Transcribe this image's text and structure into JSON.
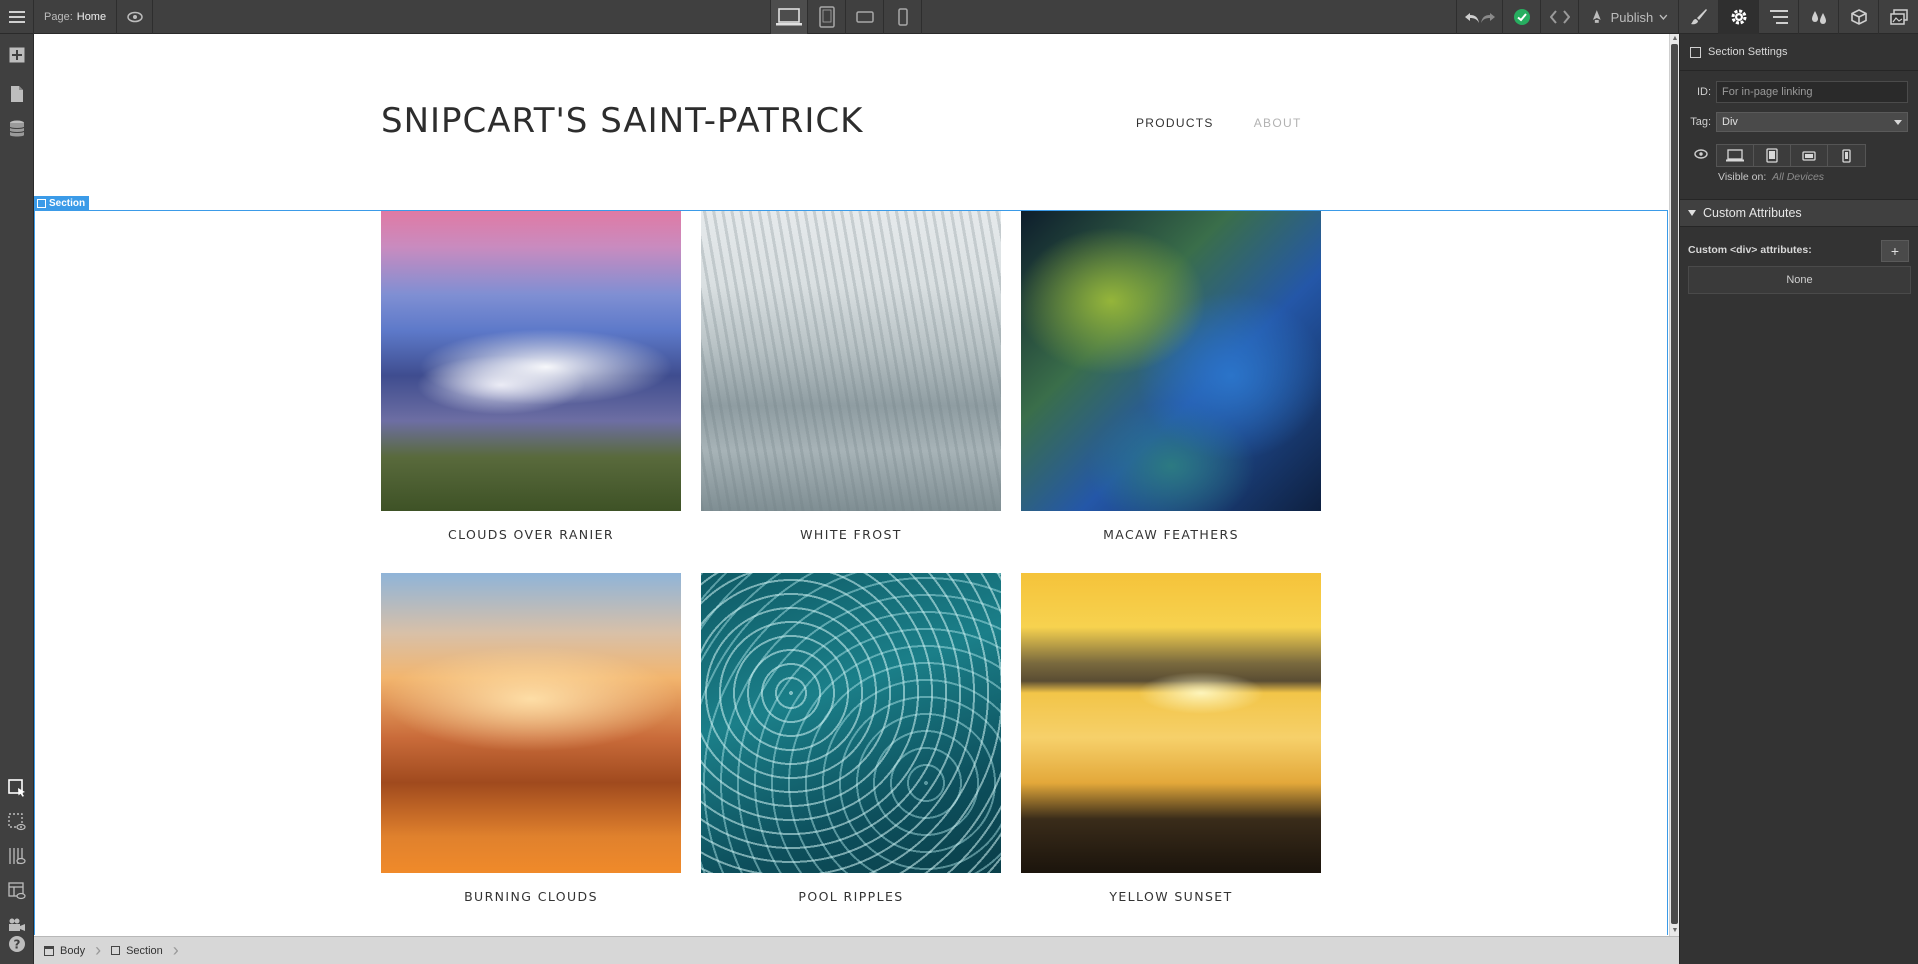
{
  "topbar": {
    "page_label": "Page:",
    "page_name": "Home",
    "publish_label": "Publish"
  },
  "site": {
    "title": "SNIPCART'S SAINT-PATRICK",
    "nav": [
      {
        "label": "PRODUCTS",
        "active": true
      },
      {
        "label": "ABOUT",
        "active": false
      }
    ]
  },
  "selection": {
    "tag_label": "Section"
  },
  "products": [
    {
      "caption": "CLOUDS OVER RANIER",
      "image": "img-clouds"
    },
    {
      "caption": "WHITE FROST",
      "image": "img-frost"
    },
    {
      "caption": "MACAW FEATHERS",
      "image": "img-macaw"
    },
    {
      "caption": "BURNING CLOUDS",
      "image": "img-burning"
    },
    {
      "caption": "POOL RIPPLES",
      "image": "img-pool"
    },
    {
      "caption": "YELLOW SUNSET",
      "image": "img-sunset"
    }
  ],
  "settings_panel": {
    "header": "Section Settings",
    "id_label": "ID:",
    "id_placeholder": "For in-page linking",
    "tag_label": "Tag:",
    "tag_value": "Div",
    "visible_label": "Visible on:",
    "visible_value": "All Devices",
    "custom_attributes_title": "Custom Attributes",
    "custom_div_label": "Custom <div> attributes:",
    "none_label": "None"
  },
  "breadcrumb": [
    {
      "label": "Body"
    },
    {
      "label": "Section"
    }
  ],
  "colors": {
    "selection_blue": "#3b9be8",
    "chrome_dark": "#404040",
    "panel_dark": "#333333",
    "status_green": "#27ae60"
  }
}
